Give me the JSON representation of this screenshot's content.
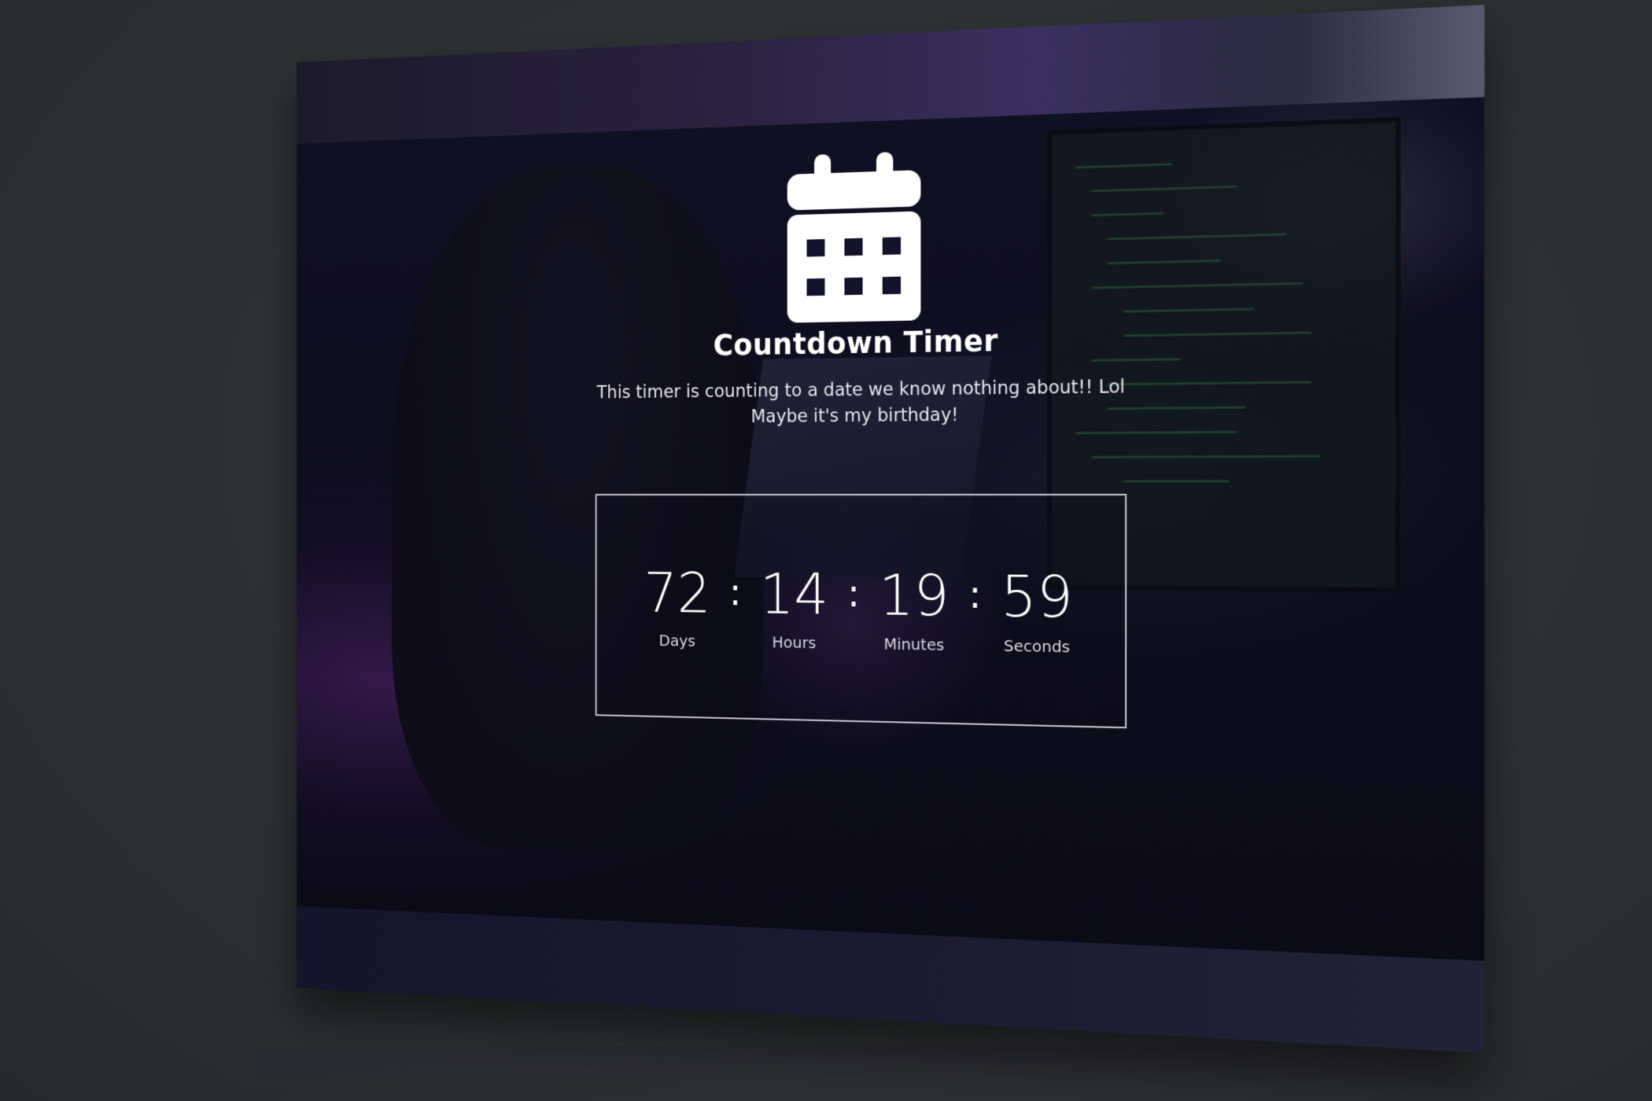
{
  "page": {
    "title": "Countdown Timer",
    "subtitle_lines": [
      "This timer is counting to a date we know nothing about!! Lol",
      "Maybe it's my birthday!"
    ]
  },
  "timer": {
    "separator": ":",
    "units": [
      {
        "value": "72",
        "label": "Days"
      },
      {
        "value": "14",
        "label": "Hours"
      },
      {
        "value": "19",
        "label": "Minutes"
      },
      {
        "value": "59",
        "label": "Seconds"
      }
    ]
  },
  "icons": {
    "header": "calendar-icon"
  },
  "colors": {
    "text": "#ffffff",
    "accent_purple": "#8a4fd0",
    "background": "#121120"
  }
}
